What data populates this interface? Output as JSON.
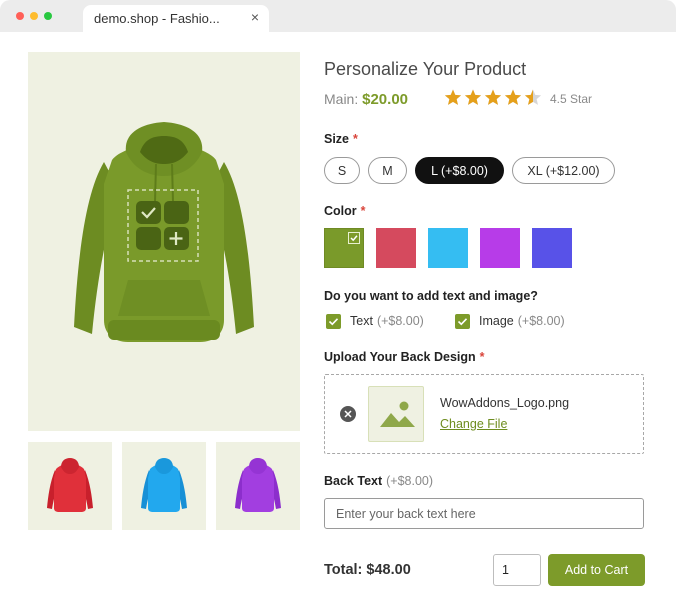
{
  "browser": {
    "tab_title": "demo.shop - Fashio...",
    "close_glyph": "×"
  },
  "product": {
    "title": "Personalize Your Product",
    "price_label": "Main:",
    "price_value": "$20.00",
    "rating": 4.5,
    "rating_text": "4.5 Star",
    "star_color": "#e5a01b"
  },
  "size": {
    "label": "Size",
    "required_mark": "*",
    "options": [
      "S",
      "M",
      "L (+$8.00)",
      "XL (+$12.00)"
    ],
    "selected": "L (+$8.00)"
  },
  "color": {
    "label": "Color",
    "required_mark": "*",
    "swatches": [
      "#7a9a2a",
      "#d54a5e",
      "#35bdf2",
      "#b73ce8",
      "#5852e8"
    ],
    "selected_index": 0
  },
  "addons": {
    "question": "Do you want to add text and image?",
    "options": [
      {
        "label": "Text",
        "price": "(+$8.00)",
        "checked": true
      },
      {
        "label": "Image",
        "price": "(+$8.00)",
        "checked": true
      }
    ]
  },
  "upload": {
    "label": "Upload Your Back Design",
    "required_mark": "*",
    "file_name": "WowAddons_Logo.png",
    "change_label": "Change File"
  },
  "back_text": {
    "label": "Back Text",
    "price": "(+$8.00)",
    "placeholder": "Enter your back text here"
  },
  "footer": {
    "total": "Total: $48.00",
    "quantity": "1",
    "add_to_cart": "Add to Cart"
  },
  "gallery": {
    "main_color": "#7a9a2a",
    "thumb_colors": [
      "#e0303a",
      "#22a8ee",
      "#a23ee0"
    ]
  },
  "theme": {
    "accent": "#7d9b2a",
    "panel_bg": "#eff1e2"
  }
}
